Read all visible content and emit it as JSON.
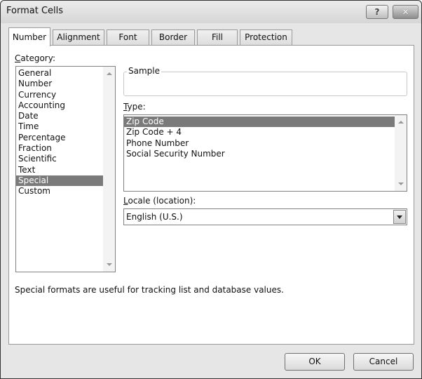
{
  "window": {
    "title": "Format Cells",
    "help_label": "?",
    "close_label": "✕"
  },
  "tabs": [
    {
      "label": "Number",
      "active": true
    },
    {
      "label": "Alignment",
      "active": false
    },
    {
      "label": "Font",
      "active": false
    },
    {
      "label": "Border",
      "active": false
    },
    {
      "label": "Fill",
      "active": false
    },
    {
      "label": "Protection",
      "active": false
    }
  ],
  "category": {
    "label_accel": "C",
    "label_rest": "ategory:",
    "items": [
      "General",
      "Number",
      "Currency",
      "Accounting",
      "Date",
      "Time",
      "Percentage",
      "Fraction",
      "Scientific",
      "Text",
      "Special",
      "Custom"
    ],
    "selected": "Special"
  },
  "sample": {
    "label": "Sample",
    "value": ""
  },
  "type": {
    "label_accel": "T",
    "label_rest": "ype:",
    "items": [
      "Zip Code",
      "Zip Code + 4",
      "Phone Number",
      "Social Security Number"
    ],
    "selected": "Zip Code"
  },
  "locale": {
    "label_accel": "L",
    "label_rest": "ocale (location):",
    "value": "English (U.S.)"
  },
  "description": "Special formats are useful for tracking list and database values.",
  "buttons": {
    "ok": "OK",
    "cancel": "Cancel"
  }
}
